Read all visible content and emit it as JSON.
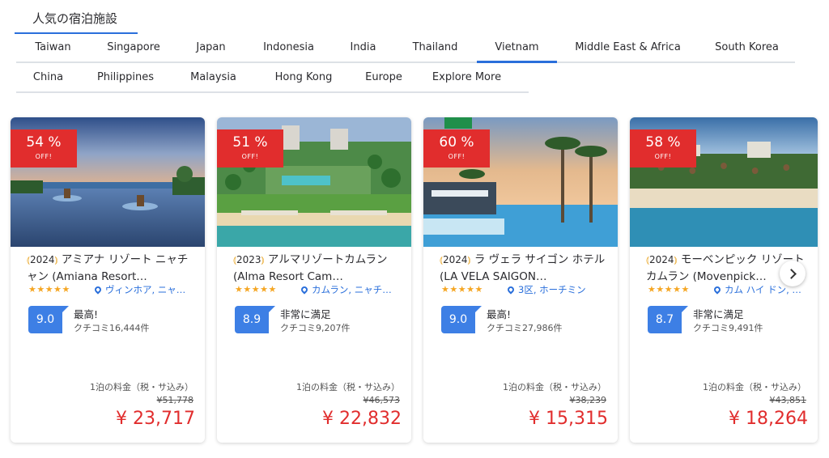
{
  "section_title": "人気の宿泊施設",
  "tabs_row1": [
    "Taiwan",
    "Singapore",
    "Japan",
    "Indonesia",
    "India",
    "Thailand",
    "Vietnam",
    "Middle East & Africa",
    "South Korea"
  ],
  "tabs_row2": [
    "China",
    "Philippines",
    "Malaysia",
    "Hong Kong",
    "Europe",
    "Explore More"
  ],
  "active_tab": "Vietnam",
  "discount_off_label": "OFF!",
  "stars": "★★★★★",
  "price_label": "1泊の料金（税・サ込み）",
  "hotels": [
    {
      "discount": "54 %",
      "year": "2024",
      "name": "アミアナ リゾート ニャチャン (Amiana Resort…",
      "location": "ヴィンホア, ニャ…",
      "score": "9.0",
      "rating_text": "最高!",
      "review_count": "クチコミ16,444件",
      "original_price": "¥51,778",
      "price": "¥ 23,717"
    },
    {
      "discount": "51 %",
      "year": "2023",
      "name": "アルマリゾートカムラン (Alma Resort Cam…",
      "location": "カムラン, ニャチ…",
      "score": "8.9",
      "rating_text": "非常に満足",
      "review_count": "クチコミ9,207件",
      "original_price": "¥46,573",
      "price": "¥ 22,832"
    },
    {
      "discount": "60 %",
      "year": "2024",
      "name": "ラ ヴェラ サイゴン ホテル (LA VELA SAIGON…",
      "location": "3区, ホーチミン",
      "score": "9.0",
      "rating_text": "最高!",
      "review_count": "クチコミ27,986件",
      "original_price": "¥38,239",
      "price": "¥ 15,315"
    },
    {
      "discount": "58 %",
      "year": "2024",
      "name": "モーベンピック リゾート カムラン (Movenpick…",
      "location": "カム ハイ ドン, ニ…",
      "score": "8.7",
      "rating_text": "非常に満足",
      "review_count": "クチコミ9,491件",
      "original_price": "¥43,851",
      "price": "¥ 18,264"
    }
  ],
  "colors": {
    "accent": "#2a6fdb",
    "discount_red": "#e12d2d",
    "score_blue": "#3d7fe5",
    "star_yellow": "#f5a623"
  },
  "icons": {
    "next": "chevron-right-icon",
    "location": "map-pin-icon"
  }
}
